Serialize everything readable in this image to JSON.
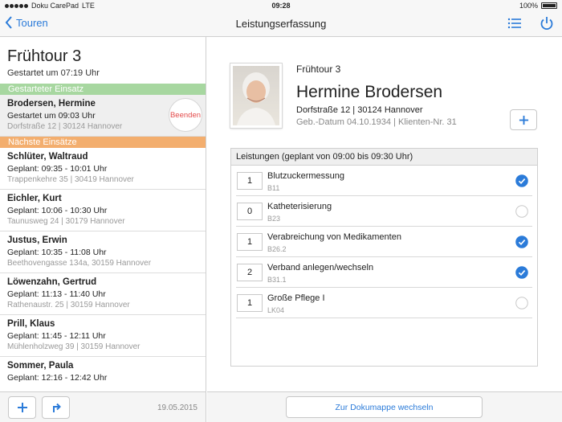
{
  "status_bar": {
    "carrier": "Doku CarePad",
    "network": "LTE",
    "time": "09:28",
    "battery": "100%"
  },
  "nav": {
    "back_label": "Touren",
    "title": "Leistungserfassung",
    "list_icon": "list-icon",
    "power_icon": "power-icon"
  },
  "left": {
    "tour_title": "Frühtour 3",
    "tour_started": "Gestartet um 07:19 Uhr",
    "section_current": "Gestarteter Einsatz",
    "current": {
      "name": "Brodersen, Hermine",
      "line": "Gestartet um 09:03 Uhr",
      "address": "Dorfstraße 12 | 30124 Hannover",
      "end_label": "Beenden"
    },
    "section_next": "Nächste Einsätze",
    "entries": [
      {
        "name": "Schlüter, Waltraud",
        "line": "Geplant: 09:35 - 10:01 Uhr",
        "address": "Trappenkehre 35 | 30419 Hannover"
      },
      {
        "name": "Eichler, Kurt",
        "line": "Geplant: 10:06 - 10:30 Uhr",
        "address": "Taunusweg 24 | 30179 Hannover"
      },
      {
        "name": "Justus, Erwin",
        "line": "Geplant: 10:35 - 11:08 Uhr",
        "address": "Beethovengasse 134a, 30159 Hannover"
      },
      {
        "name": "Löwenzahn, Gertrud",
        "line": "Geplant: 11:13 - 11:40 Uhr",
        "address": "Rathenaustr. 25 | 30159 Hannover"
      },
      {
        "name": "Prill, Klaus",
        "line": "Geplant: 11:45 - 12:11 Uhr",
        "address": "Mühlenholzweg 39 | 30159 Hannover"
      },
      {
        "name": "Sommer, Paula",
        "line": "Geplant: 12:16 - 12:42 Uhr",
        "address": ""
      }
    ],
    "date": "19.05.2015"
  },
  "right": {
    "tour": "Frühtour 3",
    "patient_name": "Hermine Brodersen",
    "address": "Dorfstraße 12 | 30124 Hannover",
    "meta": "Geb.-Datum 04.10.1934 | Klienten-Nr. 31",
    "services_header": "Leistungen (geplant von 09:00 bis 09:30 Uhr)",
    "services": [
      {
        "qty": "1",
        "name": "Blutzuckermessung",
        "code": "B11",
        "checked": true
      },
      {
        "qty": "0",
        "name": "Katheterisierung",
        "code": "B23",
        "checked": false
      },
      {
        "qty": "1",
        "name": "Verabreichung von Medikamenten",
        "code": "B26.2",
        "checked": true
      },
      {
        "qty": "2",
        "name": "Verband anlegen/wechseln",
        "code": "B31.1",
        "checked": true
      },
      {
        "qty": "1",
        "name": "Große Pflege I",
        "code": "LK04",
        "checked": false
      }
    ],
    "switch_button": "Zur Dokumappe wechseln"
  },
  "colors": {
    "accent": "#2b7bd9",
    "started_section": "#a7d7a0",
    "next_section": "#f3ae6e",
    "end_button_text": "#e34a4a"
  }
}
